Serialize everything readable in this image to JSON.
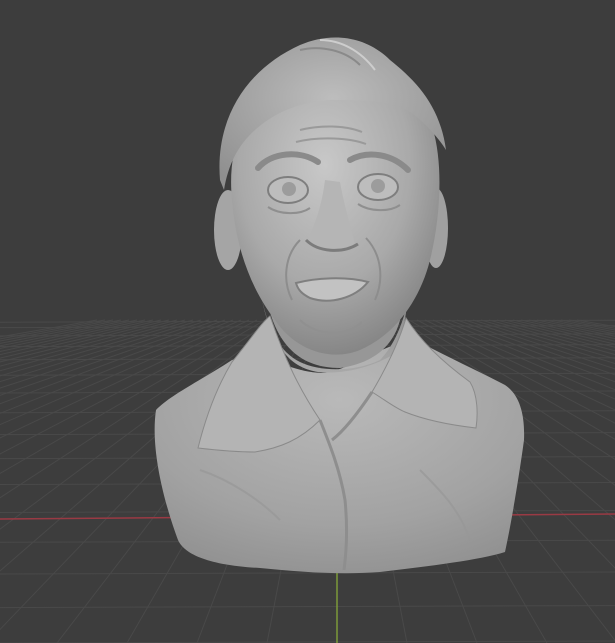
{
  "viewport": {
    "background_color": "#3d3d3d",
    "grid_color": "#494949",
    "x_axis_color": "#9a3a44",
    "y_axis_color": "#7c9a3a",
    "model_color": "#a4a4a4"
  },
  "scene": {
    "model_name": "bust-sculpture"
  }
}
